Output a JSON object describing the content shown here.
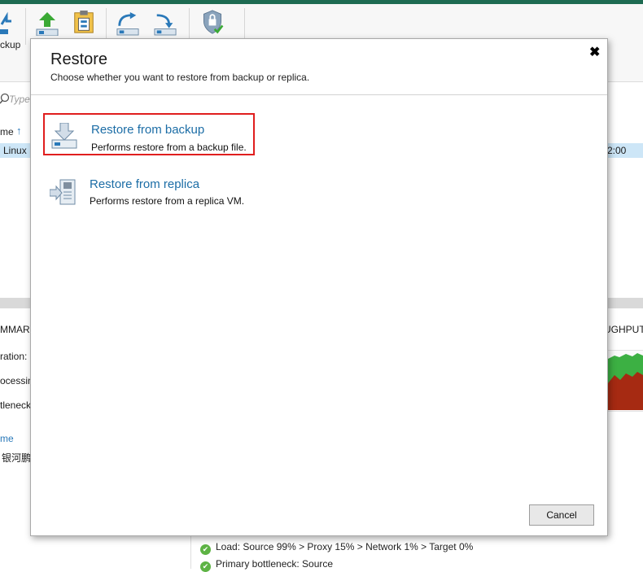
{
  "background": {
    "ribbon_label": "ckup",
    "search_placeholder": "Type",
    "column_header": "me",
    "row_left": "Linux",
    "row_right": "2:00",
    "summary_header": "MMARY",
    "throughput_header": "UGHPUT",
    "summary_rows": [
      "ration:",
      "ocessing",
      "tleneck"
    ],
    "name_link": "me",
    "name_value": "银河鹏",
    "status_lines": [
      "Load: Source 99% > Proxy 15% > Network 1% > Target 0%",
      "Primary bottleneck: Source"
    ]
  },
  "dialog": {
    "title": "Restore",
    "subtitle": "Choose whether you want to restore from backup or replica.",
    "close_glyph": "✖",
    "options": [
      {
        "title": "Restore from backup",
        "description": "Performs restore from a backup file.",
        "icon": "restore-backup-icon"
      },
      {
        "title": "Restore from replica",
        "description": "Performs restore from a replica VM.",
        "icon": "restore-replica-icon"
      }
    ],
    "cancel_label": "Cancel"
  },
  "colors": {
    "accent": "#1c6da6",
    "highlight": "#e01e1e",
    "topbar": "#1e6b52",
    "selection": "#cde6f7",
    "chart_green": "#3cb043",
    "chart_red": "#a62a12"
  }
}
